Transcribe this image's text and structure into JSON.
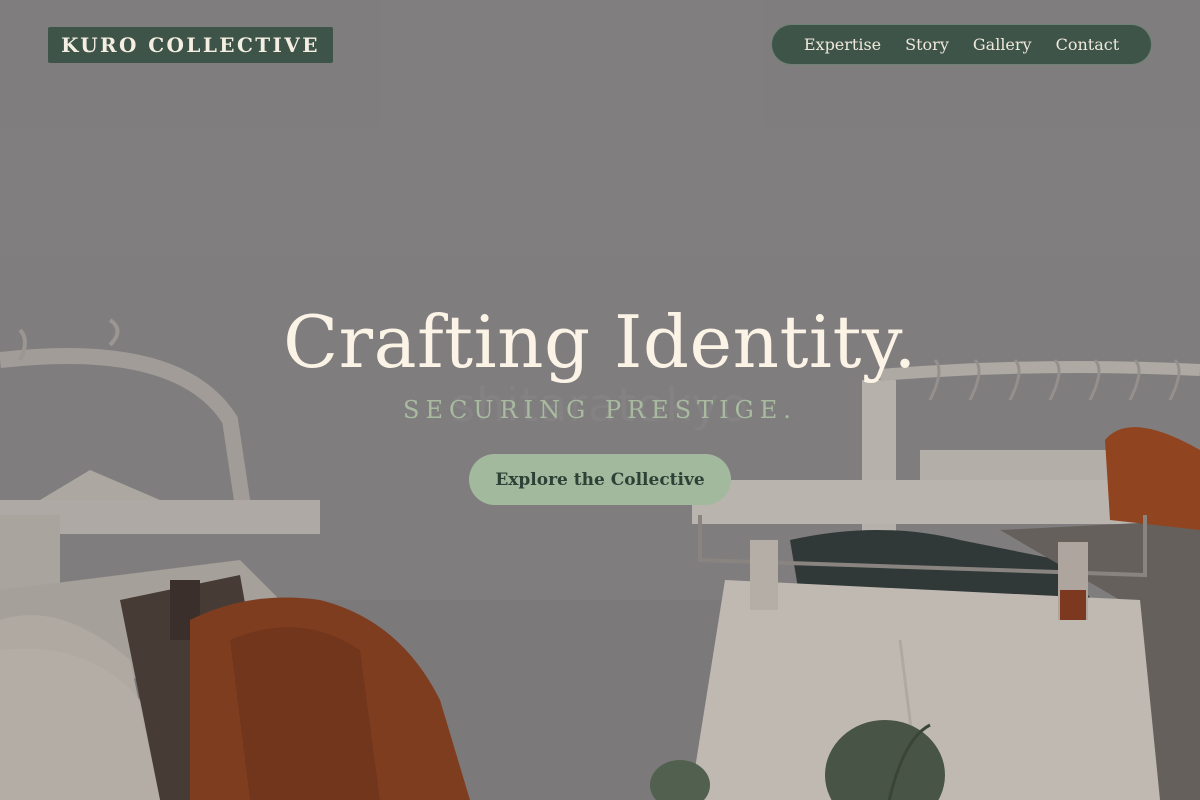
{
  "brand": {
    "name": "KURO COLLECTIVE"
  },
  "nav": {
    "items": [
      {
        "label": "Expertise"
      },
      {
        "label": "Story"
      },
      {
        "label": "Gallery"
      },
      {
        "label": "Contact"
      }
    ]
  },
  "hero": {
    "title": "Crafting Identity.",
    "subtitle": "SECURING PRESTIGE.",
    "watermark": "shitaratokyo",
    "cta_label": "Explore the Collective"
  },
  "colors": {
    "brand_green": "#3e5448",
    "cta_green": "#a3b99e",
    "cream": "#fbf3e6",
    "sage_text": "#a8bba0"
  }
}
